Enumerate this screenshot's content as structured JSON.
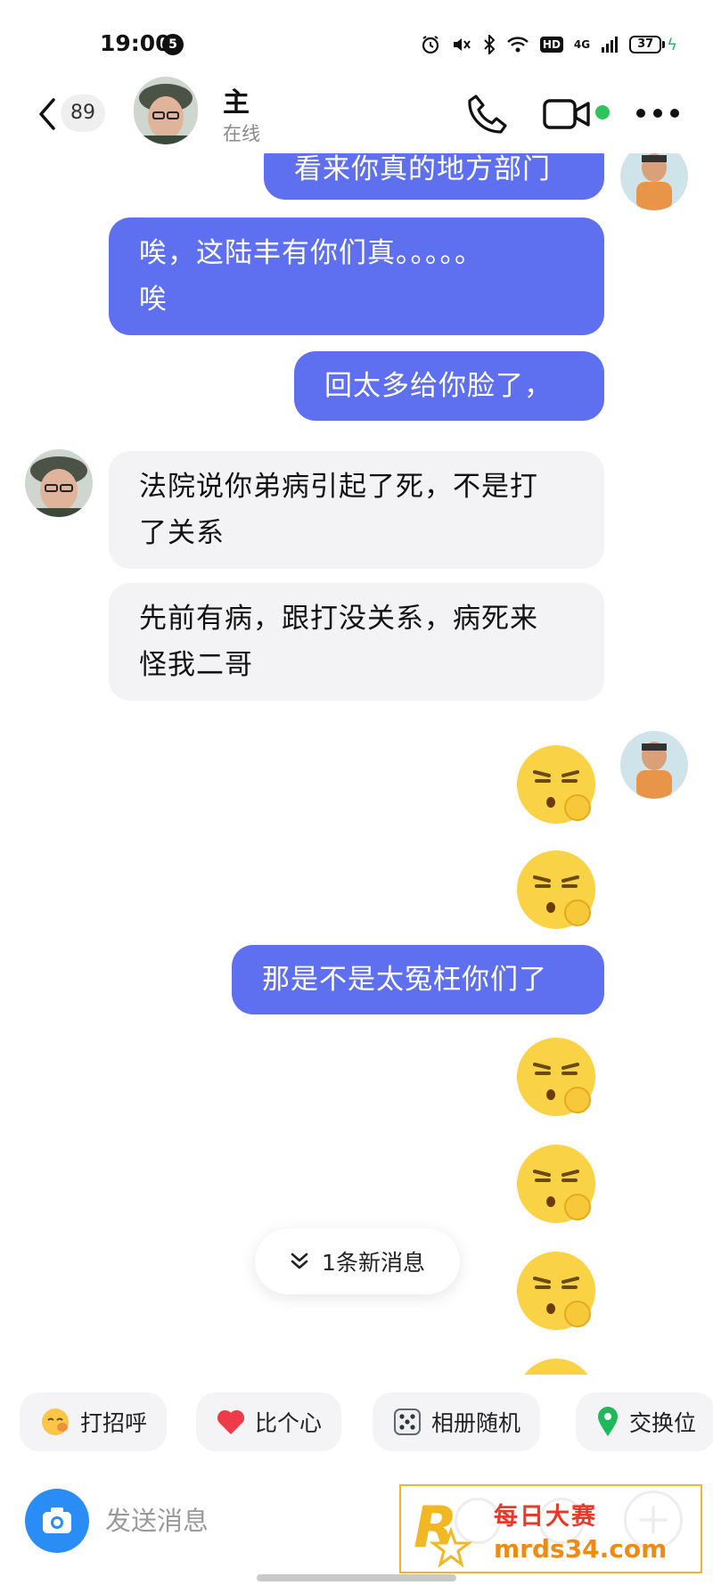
{
  "status_bar": {
    "time": "19:00",
    "notification_count": "5",
    "network": "4G",
    "hd": "HD",
    "battery": "37"
  },
  "header": {
    "unread_count": "89",
    "contact_name": "主",
    "contact_status": "在线"
  },
  "messages": [
    {
      "direction": "out",
      "type": "text",
      "text": "看来你真的地方部门"
    },
    {
      "direction": "out",
      "type": "text",
      "lines": [
        "唉，这陆丰有你们真。。。。。",
        "唉"
      ]
    },
    {
      "direction": "out",
      "type": "text",
      "text": "回太多给你脸了，"
    },
    {
      "direction": "in",
      "type": "text",
      "lines": [
        "法院说你弟病引起了死，不是打",
        "了关系"
      ]
    },
    {
      "direction": "in",
      "type": "text",
      "lines": [
        "先前有病，跟打没关系，病死来",
        "怪我二哥"
      ]
    },
    {
      "direction": "out",
      "type": "emoji",
      "icon": "thinking-face-icon"
    },
    {
      "direction": "out",
      "type": "emoji",
      "icon": "thinking-face-icon"
    },
    {
      "direction": "out",
      "type": "text",
      "text": "那是不是太冤枉你们了"
    },
    {
      "direction": "out",
      "type": "emoji",
      "icon": "thinking-face-icon"
    },
    {
      "direction": "out",
      "type": "emoji",
      "icon": "thinking-face-icon"
    },
    {
      "direction": "out",
      "type": "emoji",
      "icon": "thinking-face-icon"
    }
  ],
  "new_messages_pill": "1条新消息",
  "quick_actions": [
    {
      "label": "打招呼",
      "icon": "wave-emoji-icon"
    },
    {
      "label": "比个心",
      "icon": "heart-icon"
    },
    {
      "label": "相册随机",
      "icon": "dice-icon"
    },
    {
      "label": "交换位",
      "icon": "location-pin-icon"
    }
  ],
  "input": {
    "placeholder": "发送消息"
  },
  "watermark": {
    "title": "每日大赛",
    "site": "mrds34.com"
  },
  "colors": {
    "outgoing_bubble": "#5e6ff0",
    "incoming_bubble": "#f3f3f5",
    "online": "#2ec35c",
    "camera_button": "#2a8cf5"
  }
}
